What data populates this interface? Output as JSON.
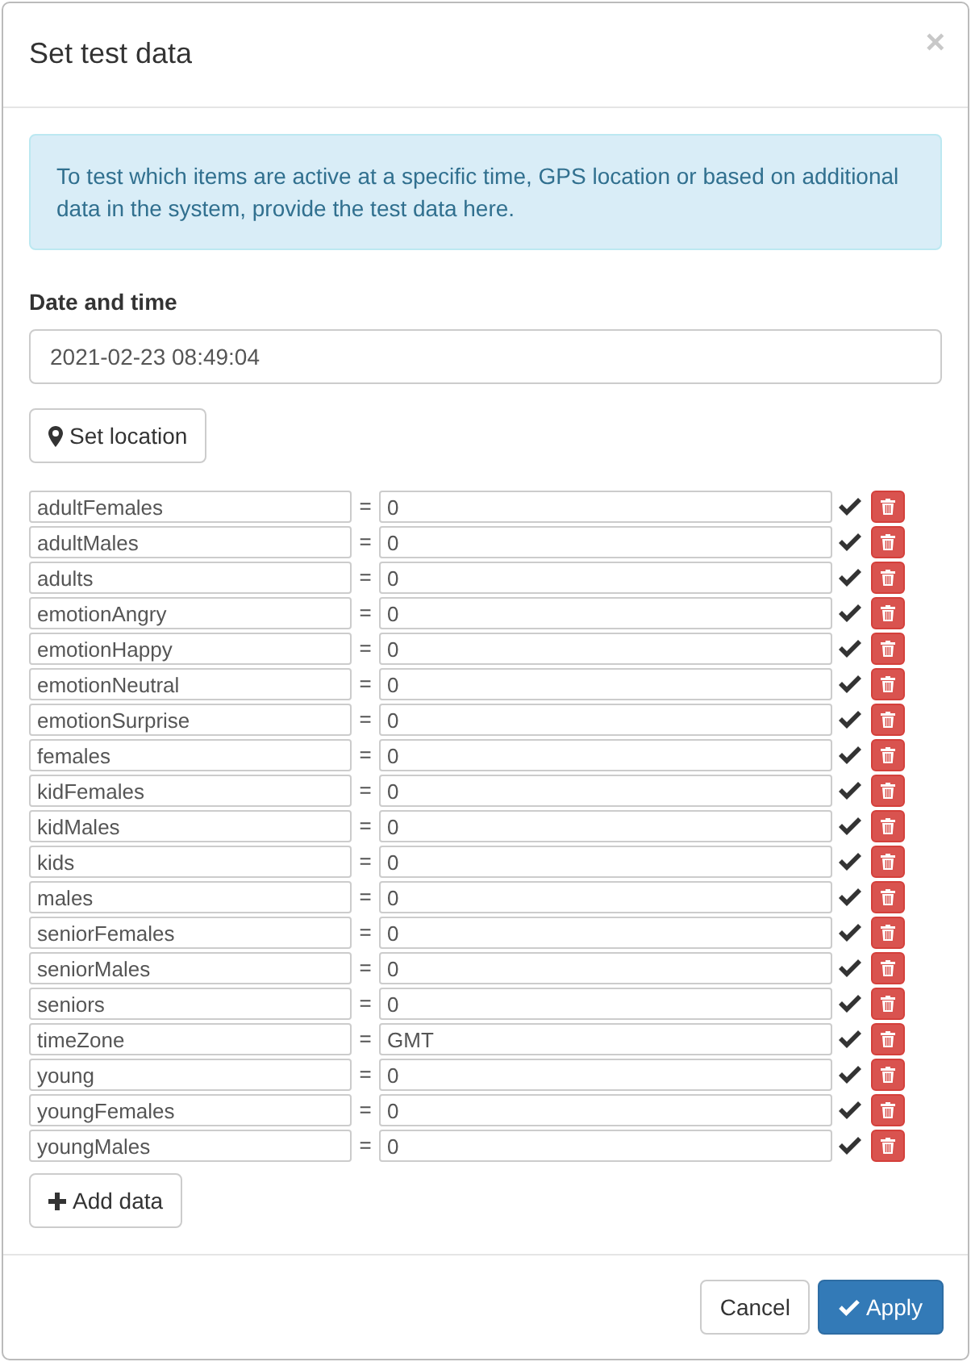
{
  "dialog": {
    "title": "Set test data",
    "close": "×"
  },
  "info": "To test which items are active at a specific time, GPS location or based on additional data in the system, provide the test data here.",
  "date_time": {
    "label": "Date and time",
    "value": "2021-02-23 08:49:04"
  },
  "set_location_button": "Set location",
  "data_rows": [
    {
      "key": "adultFemales",
      "operator": "=",
      "value": "0"
    },
    {
      "key": "adultMales",
      "operator": "=",
      "value": "0"
    },
    {
      "key": "adults",
      "operator": "=",
      "value": "0"
    },
    {
      "key": "emotionAngry",
      "operator": "=",
      "value": "0"
    },
    {
      "key": "emotionHappy",
      "operator": "=",
      "value": "0"
    },
    {
      "key": "emotionNeutral",
      "operator": "=",
      "value": "0"
    },
    {
      "key": "emotionSurprise",
      "operator": "=",
      "value": "0"
    },
    {
      "key": "females",
      "operator": "=",
      "value": "0"
    },
    {
      "key": "kidFemales",
      "operator": "=",
      "value": "0"
    },
    {
      "key": "kidMales",
      "operator": "=",
      "value": "0"
    },
    {
      "key": "kids",
      "operator": "=",
      "value": "0"
    },
    {
      "key": "males",
      "operator": "=",
      "value": "0"
    },
    {
      "key": "seniorFemales",
      "operator": "=",
      "value": "0"
    },
    {
      "key": "seniorMales",
      "operator": "=",
      "value": "0"
    },
    {
      "key": "seniors",
      "operator": "=",
      "value": "0"
    },
    {
      "key": "timeZone",
      "operator": "=",
      "value": "GMT"
    },
    {
      "key": "young",
      "operator": "=",
      "value": "0"
    },
    {
      "key": "youngFemales",
      "operator": "=",
      "value": "0"
    },
    {
      "key": "youngMales",
      "operator": "=",
      "value": "0"
    }
  ],
  "add_data_button": "Add data",
  "footer_buttons": [
    {
      "label": "Cancel",
      "kind": "secondary"
    },
    {
      "label": "Apply",
      "kind": "primary"
    }
  ]
}
